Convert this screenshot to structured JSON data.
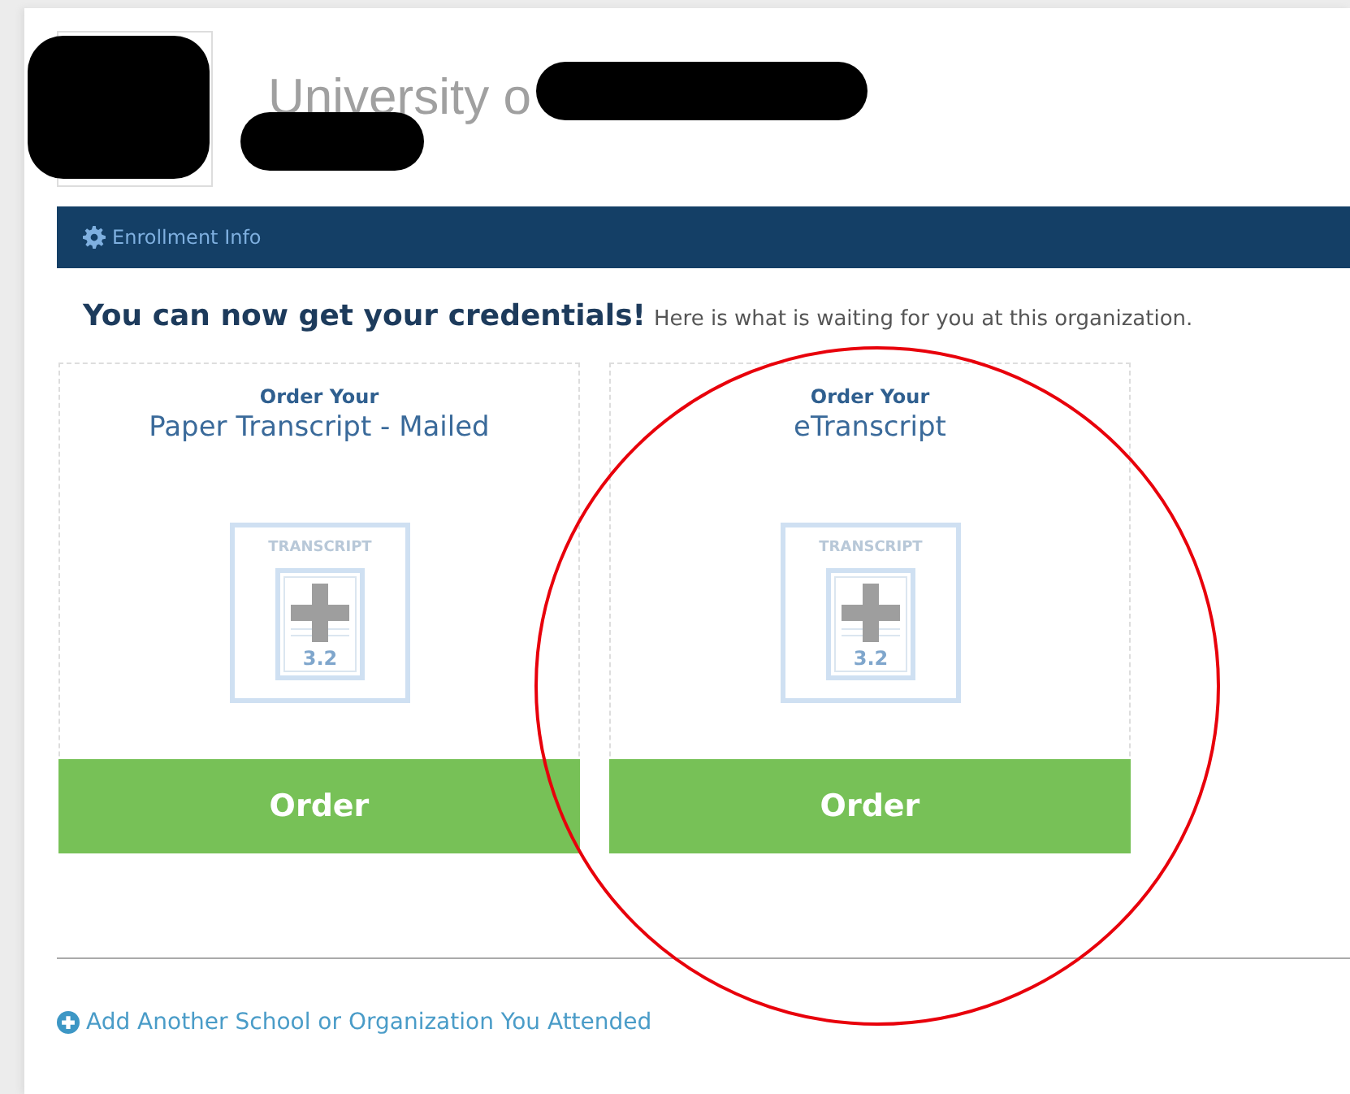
{
  "header": {
    "title": "University o"
  },
  "nav_bar": {
    "label": "Enrollment Info"
  },
  "intro": {
    "heading": "You can now get your credentials!",
    "text": "Here is what is waiting for you at this organization."
  },
  "cards": [
    {
      "kicker": "Order Your",
      "title": "Paper Transcript - Mailed",
      "icon_label": "TRANSCRIPT",
      "icon_value": "3.2",
      "button": "Order",
      "highlighted": false
    },
    {
      "kicker": "Order Your",
      "title": "eTranscript",
      "icon_label": "TRANSCRIPT",
      "icon_value": "3.2",
      "button": "Order",
      "highlighted": true
    }
  ],
  "add_link": "Add Another School or Organization You Attended"
}
